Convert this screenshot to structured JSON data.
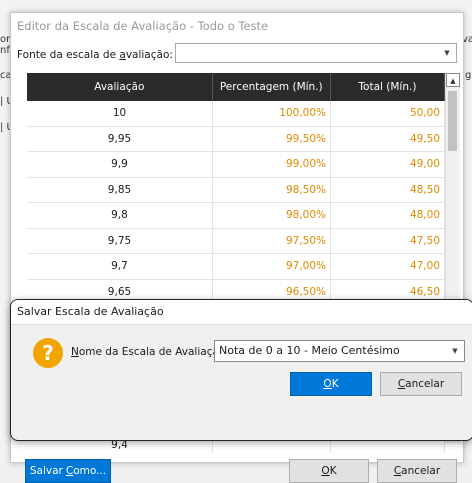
{
  "background": {
    "fragments": [
      {
        "text": "ori"
      },
      {
        "text": "nf"
      },
      {
        "text": "ca"
      },
      {
        "text": "| U"
      },
      {
        "text": "| U"
      }
    ],
    "right_fragments": [
      {
        "text": "va"
      },
      {
        "text": "g"
      }
    ]
  },
  "editor": {
    "title": "Editor da Escala de Avaliação - Todo o Teste",
    "source_label": "Fonte da escala de avaliação:",
    "source_value": "",
    "columns": [
      "Avaliação",
      "Percentagem (Mín.)",
      "Total (Mín.)"
    ],
    "rows": [
      {
        "grade": "10",
        "percent": "100,00%",
        "total": "50,00"
      },
      {
        "grade": "9,95",
        "percent": "99,50%",
        "total": "49,50"
      },
      {
        "grade": "9,9",
        "percent": "99,00%",
        "total": "49,00"
      },
      {
        "grade": "9,85",
        "percent": "98,50%",
        "total": "48,50"
      },
      {
        "grade": "9,8",
        "percent": "98,00%",
        "total": "48,00"
      },
      {
        "grade": "9,75",
        "percent": "97,50%",
        "total": "47,50"
      },
      {
        "grade": "9,7",
        "percent": "97,00%",
        "total": "47,00"
      },
      {
        "grade": "9,65",
        "percent": "96,50%",
        "total": "46,50"
      },
      {
        "grade": "",
        "percent": "",
        "total": ""
      },
      {
        "grade": "",
        "percent": "",
        "total": ""
      },
      {
        "grade": "",
        "percent": "",
        "total": ""
      },
      {
        "grade": "",
        "percent": "",
        "total": ""
      },
      {
        "grade": "",
        "percent": "",
        "total": ""
      },
      {
        "grade": "9,4",
        "percent": "",
        "total": ""
      }
    ],
    "buttons": {
      "save_as": "Salvar Como...",
      "ok": "OK",
      "cancel": "Cancelar"
    }
  },
  "save_dialog": {
    "title": "Salvar Escala de Avaliação",
    "name_label": "Nome da Escala de Avaliação",
    "name_value": "Nota de 0 a 10 - Meio Centésimo",
    "buttons": {
      "ok": "OK",
      "cancel": "Cancelar"
    }
  },
  "colors": {
    "accent": "#0078d7",
    "value_text": "#e08a00",
    "header_bg": "#2b2b2b"
  }
}
